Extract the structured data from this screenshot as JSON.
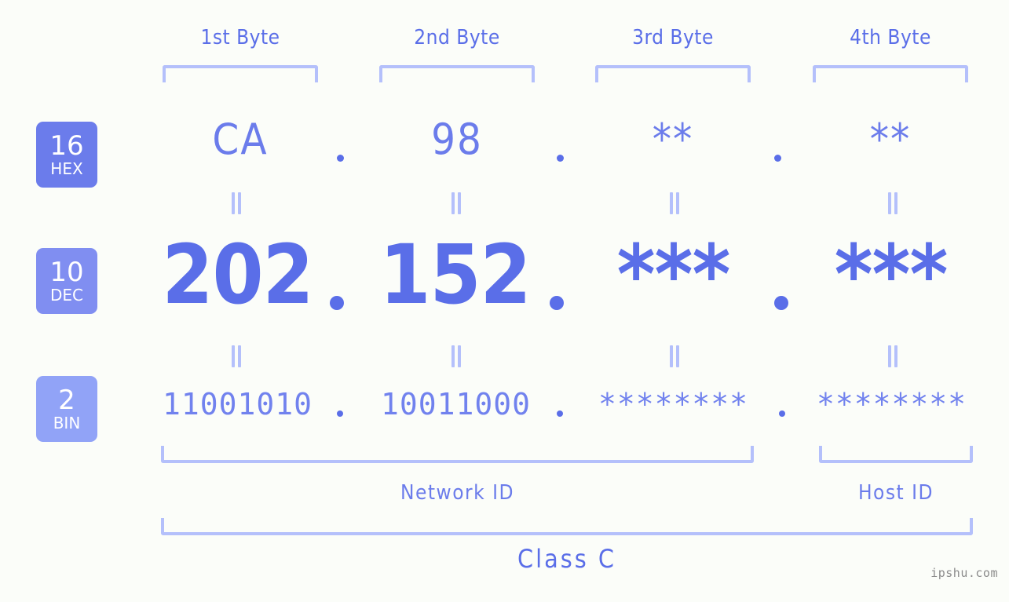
{
  "background_color": "#fbfdf9",
  "accent_color": "#5a6ee8",
  "line_color": "#b4c0fb",
  "headers": [
    {
      "label": "1st Byte"
    },
    {
      "label": "2nd Byte"
    },
    {
      "label": "3rd Byte"
    },
    {
      "label": "4th Byte"
    }
  ],
  "badges": [
    {
      "num": "16",
      "sys": "HEX",
      "color": "#6b7ceb"
    },
    {
      "num": "10",
      "sys": "DEC",
      "color": "#808ef1"
    },
    {
      "num": "2",
      "sys": "BIN",
      "color": "#91a3f7"
    }
  ],
  "rows": {
    "hex": {
      "values": [
        "CA",
        "98",
        "**",
        "**"
      ]
    },
    "dec": {
      "values": [
        "202",
        "152",
        "***",
        "***"
      ]
    },
    "bin": {
      "values": [
        "11001010",
        "10011000",
        "********",
        "********"
      ]
    }
  },
  "separator": ".",
  "equals_mark": "=",
  "sections": {
    "network_id": "Network ID",
    "host_id": "Host ID"
  },
  "class_label": "Class C",
  "watermark": "ipshu.com"
}
